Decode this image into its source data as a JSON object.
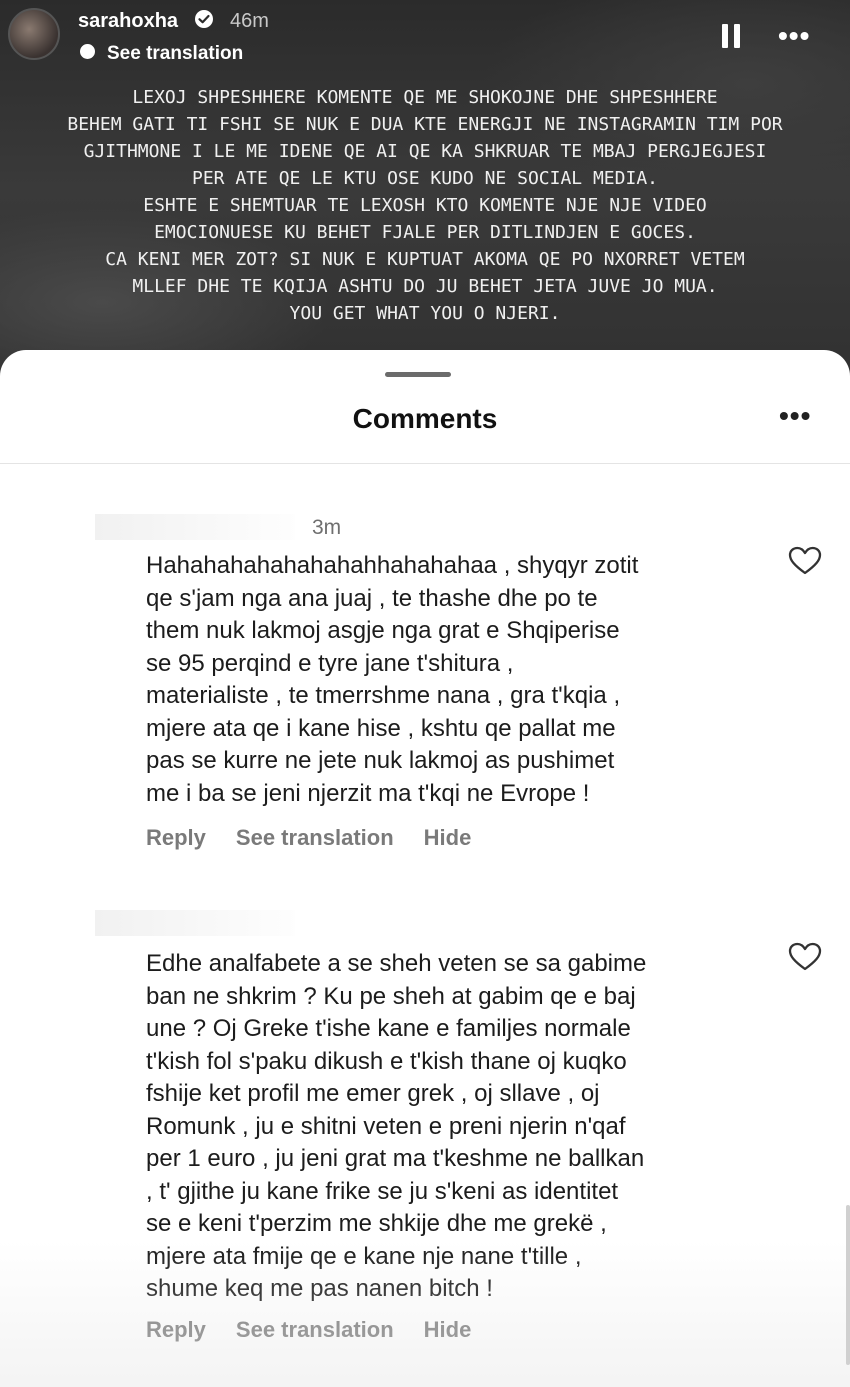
{
  "story": {
    "username": "sarahoxha",
    "time_ago": "46m",
    "see_translation": "See translation",
    "icons": [
      "verified-badge-icon",
      "pause-icon",
      "more-icon",
      "translate-icon"
    ],
    "text_lines": [
      "LEXOJ SHPESHHERE KOMENTE QE ME SHOKOJNE DHE SHPESHHERE",
      "BEHEM GATI TI FSHI SE NUK E DUA KTE ENERGJI NE INSTAGRAMIN TIM POR",
      "GJITHMONE I LE ME IDENE QE AI QE KA SHKRUAR TE MBAJ PERGJEGJESI",
      "PER ATE QE LE KTU OSE KUDO NE SOCIAL MEDIA.",
      "ESHTE E SHEMTUAR TE LEXOSH KTO KOMENTE NJE NJE VIDEO",
      "EMOCIONUESE KU BEHET FJALE PER DITLINDJEN E GOCES.",
      "CA KENI MER ZOT? SI NUK E KUPTUAT AKOMA QE PO NXORRET VETEM",
      "MLLEF DHE TE KQIJA ASHTU DO JU BEHET JETA JUVE JO MUA.",
      "YOU GET WHAT YOU O NJERI."
    ]
  },
  "comments_sheet": {
    "title": "Comments",
    "comments": [
      {
        "time": "3m",
        "text": "Hahahahahahahahahhahahahaa , shyqyr zotit\nqe s'jam nga ana juaj , te thashe dhe po te\nthem nuk lakmoj asgje nga grat e Shqiperise\nse 95 perqind e tyre jane t'shitura ,\nmaterialiste , te tmerrshme nana , gra t'kqia ,\nmjere ata qe i kane hise , kshtu qe pallat me\npas se kurre ne jete nuk lakmoj as pushimet\nme i ba se jeni njerzit ma t'kqi ne Evrope !",
        "reply": "Reply",
        "see_translation": "See translation",
        "hide": "Hide"
      },
      {
        "time": "",
        "text": "Edhe analfabete a se sheh veten se sa gabime\nban ne shkrim ? Ku pe sheh at gabim qe e baj\nune ? Oj Greke t'ishe kane e familjes normale\nt'kish fol s'paku dikush e t'kish thane oj kuqko\nfshije ket profil me emer grek , oj sllave , oj\nRomunk , ju e shitni veten e preni njerin n'qaf\nper 1 euro , ju jeni grat ma t'keshme ne ballkan\n, t' gjithe ju kane frike se ju s'keni as identitet\nse e keni t'perzim me shkije dhe me grekë ,\nmjere ata fmije qe e kane nje nane t'tille ,\nshume keq me pas nanen bitch !",
        "reply": "Reply",
        "see_translation": "See translation",
        "hide": "Hide"
      }
    ]
  }
}
